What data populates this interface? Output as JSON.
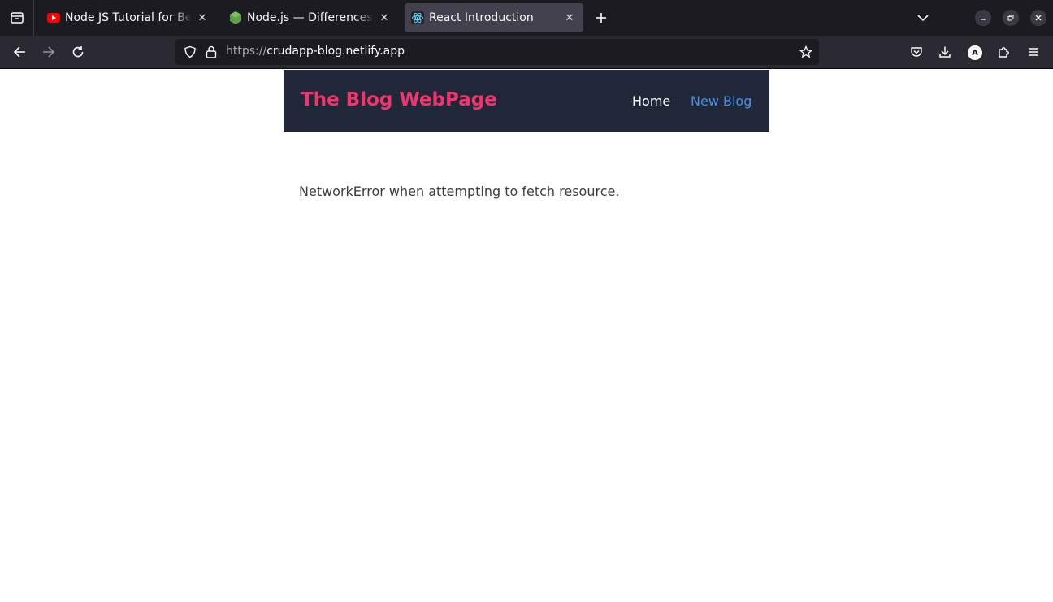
{
  "browser": {
    "tabs": [
      {
        "title": "Node JS Tutorial for Beginners",
        "icon": "youtube-icon",
        "active": false
      },
      {
        "title": "Node.js — Differences between",
        "icon": "nodejs-icon",
        "active": false
      },
      {
        "title": "React Introduction",
        "icon": "react-icon",
        "active": true
      }
    ],
    "address": {
      "scheme": "https://",
      "host": "crudapp-blog.netlify.app"
    },
    "profile_initial": "A",
    "colors": {
      "tabstrip_bg": "#1c1b22",
      "toolbar_bg": "#2b2a33",
      "active_tab_bg": "#42414d"
    }
  },
  "site": {
    "title": "The Blog WebPage",
    "nav": {
      "home": "Home",
      "new_blog": "New Blog"
    },
    "error_message": "NetworkError when attempting to fetch resource.",
    "colors": {
      "navbar_bg": "#1f2738",
      "brand": "#f1356d",
      "link_active": "#4a90e2"
    }
  }
}
